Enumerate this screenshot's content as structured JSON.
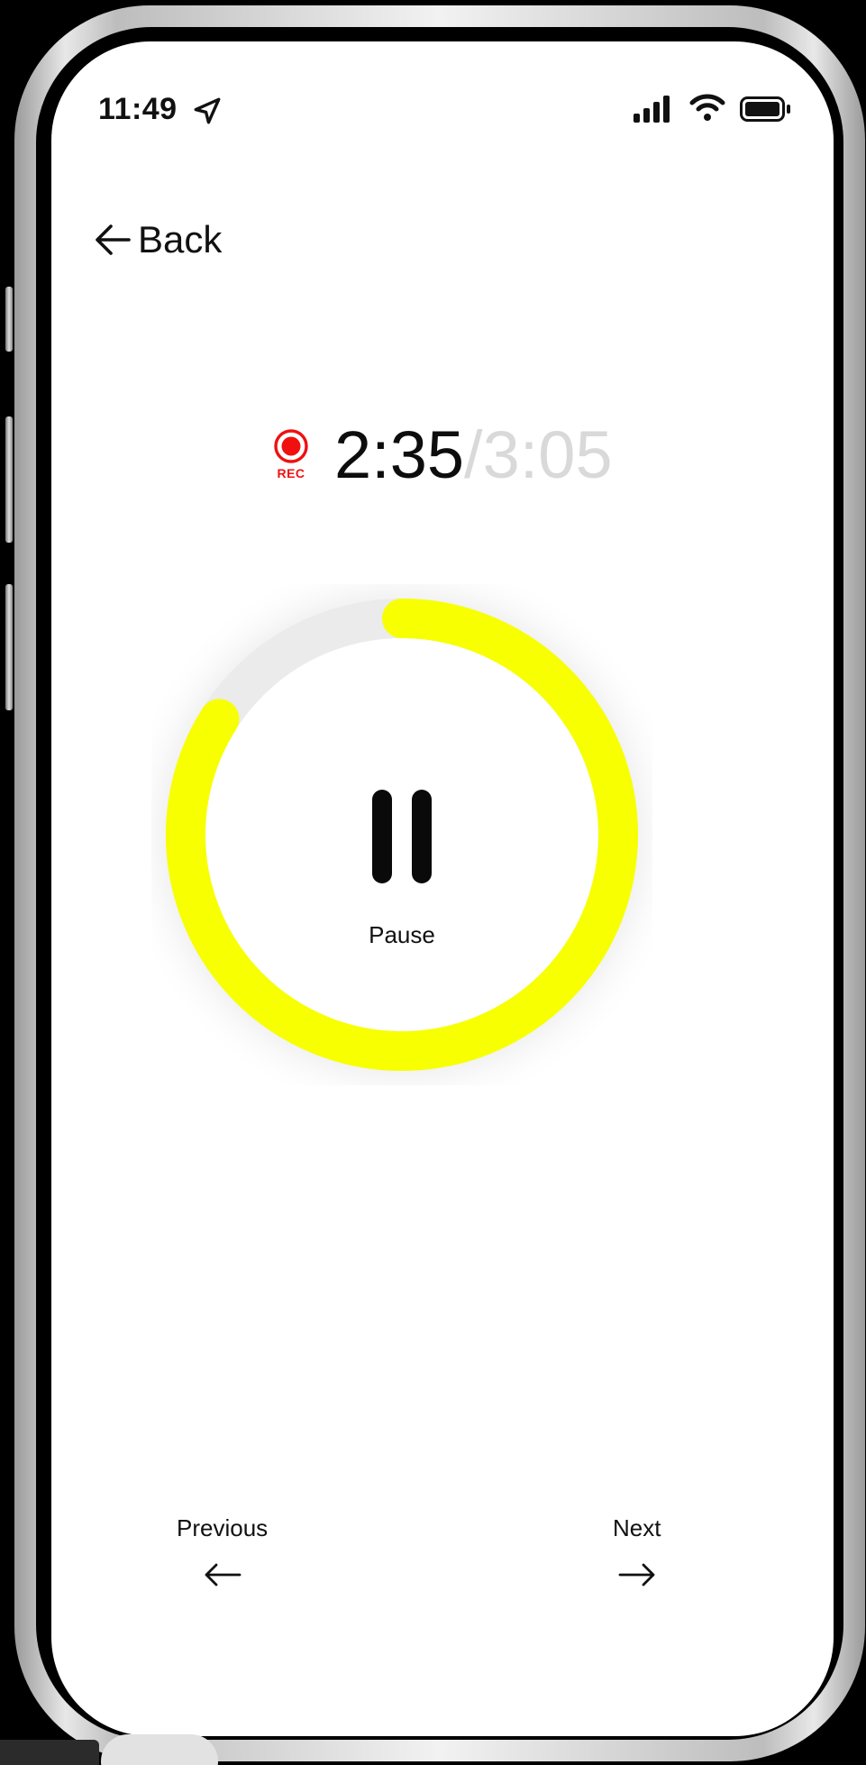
{
  "status_bar": {
    "time": "11:49",
    "icons": [
      "location-arrow-icon",
      "cellular-signal-icon",
      "wifi-icon",
      "battery-icon"
    ]
  },
  "nav": {
    "back_label": "Back"
  },
  "recorder": {
    "rec_label": "REC",
    "elapsed": "2:35",
    "total": "/3:05",
    "progress": 0.84,
    "accent_color": "#F7FF00",
    "track_color": "#EBEBEB",
    "rec_color": "#F01010"
  },
  "controls": {
    "pause_label": "Pause",
    "previous_label": "Previous",
    "next_label": "Next"
  }
}
